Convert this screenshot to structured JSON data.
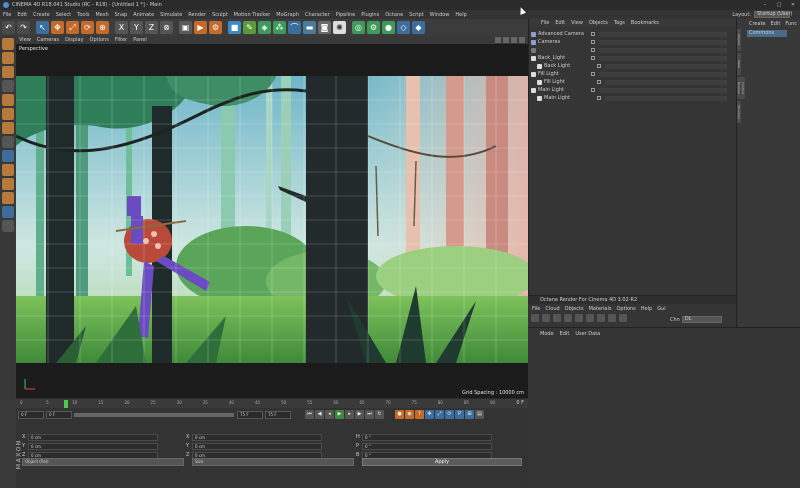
{
  "window": {
    "title": "CINEMA 4D R18.041 Studio (RC - R18) - [Untitled 1 *] - Main",
    "controls": [
      "–",
      "□",
      "✕"
    ]
  },
  "menubar": [
    "File",
    "Edit",
    "Create",
    "Select",
    "Tools",
    "Mesh",
    "Snap",
    "Animate",
    "Simulate",
    "Render",
    "Sculpt",
    "Motion Tracker",
    "MoGraph",
    "Character",
    "Pipeline",
    "Plugins",
    "Octane",
    "Script",
    "Window",
    "Help"
  ],
  "layout": {
    "label": "Layout:",
    "value": "Startup (User)"
  },
  "viewport": {
    "menu": [
      "View",
      "Cameras",
      "Display",
      "Options",
      "Filter",
      "Panel"
    ],
    "label": "Perspective",
    "grid_spacing": "Grid Spacing : 10000 cm"
  },
  "timeline": {
    "ticks": [
      "0",
      "5",
      "10",
      "15",
      "20",
      "25",
      "30",
      "35",
      "40",
      "45",
      "50",
      "55",
      "60",
      "65",
      "70",
      "75",
      "80",
      "85",
      "90"
    ],
    "end_label": "0 F"
  },
  "transport": {
    "start": "0 F",
    "current": "0 F",
    "end": "75 F",
    "end2": "75 F"
  },
  "coords": {
    "rows": [
      {
        "k": "X",
        "v": "0 cm",
        "k2": "X",
        "v2": "0 cm",
        "k3": "H",
        "v3": "0 °"
      },
      {
        "k": "Y",
        "v": "0 cm",
        "k2": "Y",
        "v2": "0 cm",
        "k3": "P",
        "v3": "0 °"
      },
      {
        "k": "Z",
        "v": "0 cm",
        "k2": "Z",
        "v2": "0 cm",
        "k3": "B",
        "v3": "0 °"
      }
    ],
    "mode": "Object (Rel)",
    "size_mode": "Size",
    "apply": "Apply"
  },
  "brand": "MAXON",
  "objects": {
    "menu": [
      "File",
      "Edit",
      "View",
      "Objects",
      "Tags",
      "Bookmarks"
    ],
    "items": [
      {
        "name": "Advanced Camera",
        "color": "#8aa0c8",
        "indent": 0
      },
      {
        "name": "Cameras",
        "color": "#8aa0c8",
        "indent": 0
      },
      {
        "name": "",
        "color": "#777",
        "indent": 0
      },
      {
        "name": "Back_Light",
        "color": "#ddd",
        "indent": 0
      },
      {
        "name": "Back Light",
        "color": "#ddd",
        "indent": 1
      },
      {
        "name": "Fill Light",
        "color": "#ddd",
        "indent": 0
      },
      {
        "name": "Fill Light",
        "color": "#ddd",
        "indent": 1
      },
      {
        "name": "Main Light",
        "color": "#ddd",
        "indent": 0
      },
      {
        "name": "Main Light",
        "color": "#ddd",
        "indent": 1
      }
    ]
  },
  "octane": {
    "title": "Octane Render For Cinema 4D 3.02-R2",
    "menu": [
      "File",
      "Cloud",
      "Objects",
      "Materials",
      "Options",
      "Help",
      "Gui"
    ],
    "channel_label": "Chn",
    "channel_value": "DL"
  },
  "attributes": {
    "menu": [
      "Mode",
      "Edit",
      "User Data"
    ]
  },
  "right_panel": {
    "menu": [
      "Create",
      "Edit",
      "Func"
    ],
    "item": "Commons",
    "tabs": [
      "Objects",
      "Takes",
      "Content Browser",
      "Structure"
    ]
  }
}
